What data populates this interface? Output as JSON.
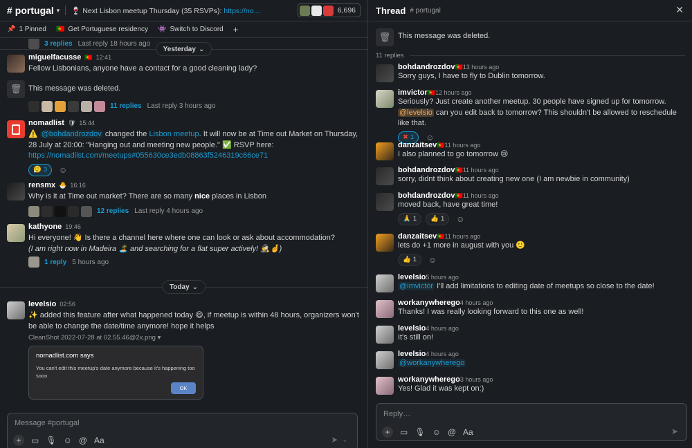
{
  "channel": {
    "name": "portugal",
    "topic_text": "🍷 Next Lisbon meetup Thursday (35 RSVPs): ",
    "topic_link": "https://no...",
    "member_count": "6,696",
    "bookmarks": [
      {
        "icon": "pin-icon",
        "label": "1 Pinned"
      },
      {
        "icon": "flag-icon",
        "label": "Get Portuguese residency"
      },
      {
        "icon": "discord-icon",
        "label": "Switch to Discord"
      }
    ],
    "add_bookmark": "+"
  },
  "feed": {
    "top_partial": {
      "replies": "3 replies",
      "last": "Last reply 18 hours ago"
    },
    "divider_yesterday": "Yesterday",
    "divider_today": "Today",
    "messages": [
      {
        "user": "miguelfacusse",
        "time": "12:41",
        "text": "Fellow Lisbonians, anyone have a contact for a good cleaning lady?"
      },
      {
        "deleted": "This message was deleted.",
        "replies": "11 replies",
        "last": "Last reply 3 hours ago"
      },
      {
        "user": "nomadlist",
        "time": "15:44",
        "mention": "@bohdandrozdov",
        "text_a": " changed the ",
        "link_a": "Lisbon meetup",
        "text_b": ". It will now be at Time out Market on Thursday, 28 July at 20:00: \"Hanging out and meeting new people.\" ✅ RSVP here:",
        "link_b": "https://nomadlist.com/meetups#055630ce3edb08863f5246319c66ce71",
        "react_count": "3"
      },
      {
        "user": "rensmx",
        "time": "16:16",
        "text_a": "Why is it at Time out market? There are so many ",
        "bold": "nice",
        "text_b": " places in Lisbon",
        "replies": "12 replies",
        "last": "Last reply 4 hours ago"
      },
      {
        "user": "kathyone",
        "time": "19:46",
        "text": "Hi everyone! 👋 Is there a channel here where one can look or ask about accommodation?",
        "italic": "(I am right now in Madeira 🏝️ and searching for a flat super actively! 🕵️🤞)",
        "replies": "1 reply",
        "last": "5 hours ago"
      },
      {
        "user": "levelsio",
        "time": "02:56",
        "text": "✨ added this feature after what happened today 😄, if meetup is within 48 hours, organizers won't be able to change the date/time anymore! hope it helps",
        "file": "CleanShot 2022-07-28 at 02.55.46@2x.png",
        "dialog_title": "nomadlist.com says",
        "dialog_msg": "You can't edit this meetup's date anymore because it's happening too soon",
        "dialog_ok": "OK"
      }
    ]
  },
  "composer": {
    "placeholder": "Message #portugal",
    "format": "Aa"
  },
  "thread": {
    "title": "Thread",
    "channel": "# portugal",
    "parent_deleted": "This message was deleted.",
    "reply_count": "11 replies",
    "replies": [
      {
        "user": "bohdandrozdov",
        "time": "13 hours ago",
        "text": "Sorry guys, I have to fly to Dublin tomorrow."
      },
      {
        "user": "imvictor",
        "time": "12 hours ago",
        "text_a": "Seriously? Just create another meetup. 30 people have signed up for tomorrow. ",
        "mention": "@levelsio",
        "text_b": " can you edit back to tomorrow? This shouldn't be allowed to reschedule like that.",
        "react": "1"
      },
      {
        "user": "danzaitsev",
        "time": "11 hours ago",
        "text": "I also planned to go tomorrow 😢"
      },
      {
        "user": "bohdandrozdov",
        "time": "11 hours ago",
        "text": "sorry, didnt think about creating new one (I am newbie in community)"
      },
      {
        "user": "bohdandrozdov",
        "time": "11 hours ago",
        "text": "moved back, have great time!",
        "r1": "1",
        "r2": "1"
      },
      {
        "user": "danzaitsev",
        "time": "11 hours ago",
        "text": "lets do +1 more in august with you 🙂",
        "r1": "1"
      },
      {
        "user": "levelsio",
        "time": "5 hours ago",
        "mention": "@imvictor",
        "text": " I'll add limitations to editing date of meetups so close to the date!"
      },
      {
        "user": "workanywherego",
        "time": "4 hours ago",
        "text": "Thanks! I was really looking forward to this one as well!"
      },
      {
        "user": "levelsio",
        "time": "4 hours ago",
        "text": "It's still on!"
      },
      {
        "user": "levelsio",
        "time": "4 hours ago",
        "mention": "@workanywherego"
      },
      {
        "user": "workanywherego",
        "time": "3 hours ago",
        "text": "Yes! Glad it was kept on:)"
      }
    ],
    "composer_placeholder": "Reply…",
    "format": "Aa"
  },
  "colors": {
    "link": "#1d9bd1",
    "background": "#1a1d21",
    "mention_self": "#e8a75b"
  }
}
